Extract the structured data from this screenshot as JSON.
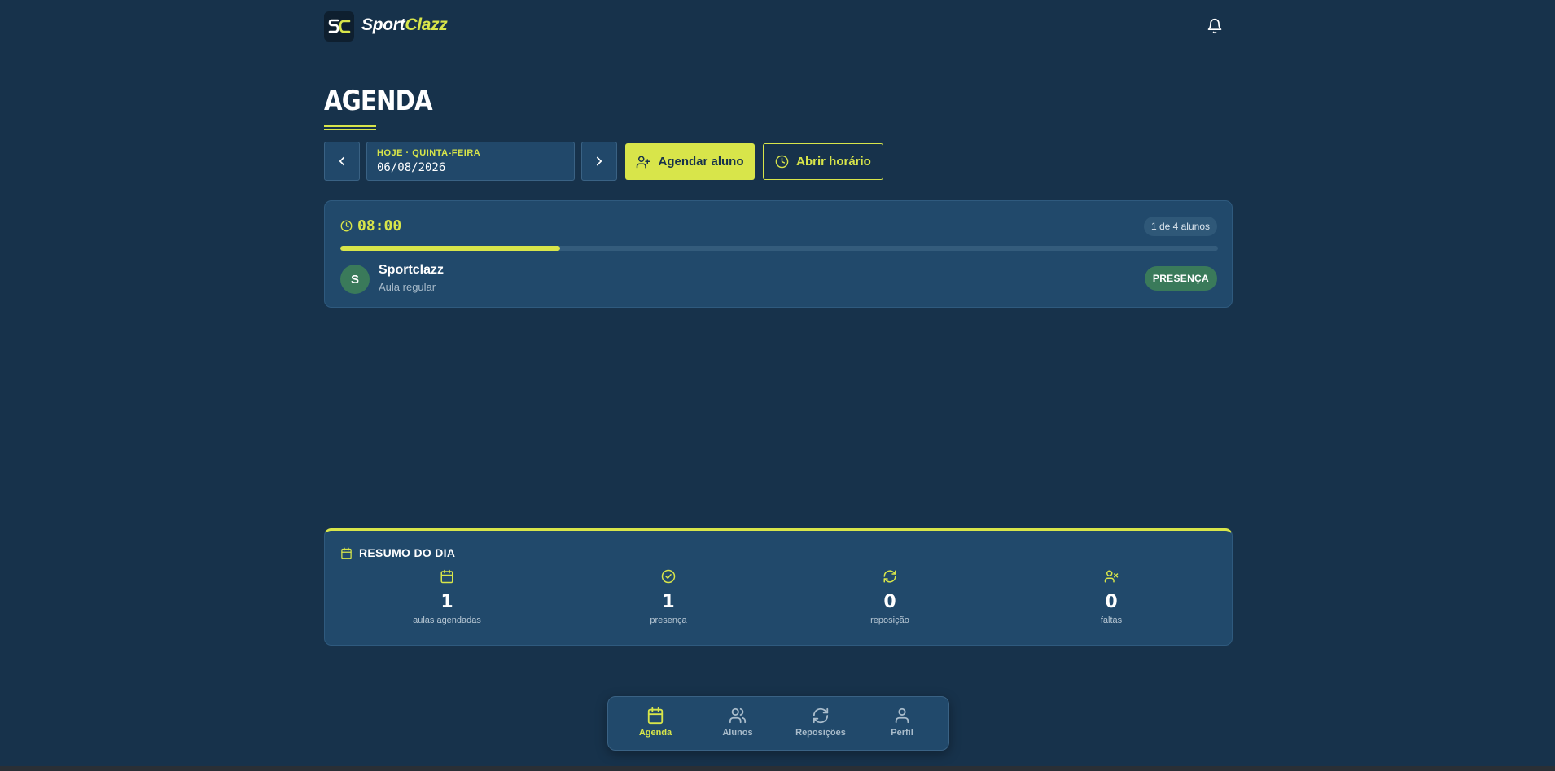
{
  "header": {
    "brand_part1": "Sport",
    "brand_part2": "Clazz",
    "logo_mark": "SC"
  },
  "page": {
    "title": "AGENDA"
  },
  "date_picker": {
    "label": "HOJE · QUINTA-FEIRA",
    "value": "06/08/2026"
  },
  "actions": {
    "schedule_student": "Agendar aluno",
    "open_slot": "Abrir horário"
  },
  "slot": {
    "time": "08:00",
    "count": "1 de 4 alunos",
    "filled": 1,
    "capacity": 4,
    "students": [
      {
        "initial": "S",
        "name": "Sportclazz",
        "type": "Aula regular",
        "status": "PRESENÇA"
      }
    ]
  },
  "summary": {
    "title": "RESUMO DO DIA",
    "stats": [
      {
        "icon": "calendar-icon",
        "value": "1",
        "label": "aulas agendadas"
      },
      {
        "icon": "check-circle-icon",
        "value": "1",
        "label": "presença"
      },
      {
        "icon": "refresh-icon",
        "value": "0",
        "label": "reposição"
      },
      {
        "icon": "user-x-icon",
        "value": "0",
        "label": "faltas"
      }
    ]
  },
  "bottom_nav": {
    "items": [
      {
        "label": "Agenda",
        "icon": "calendar-icon",
        "active": true
      },
      {
        "label": "Alunos",
        "icon": "users-icon",
        "active": false
      },
      {
        "label": "Reposições",
        "icon": "refresh-icon",
        "active": false
      },
      {
        "label": "Perfil",
        "icon": "user-icon",
        "active": false
      }
    ]
  },
  "colors": {
    "background": "#17324b",
    "card": "#21496b",
    "accent": "#d8e54a",
    "success": "#3a7a5a"
  }
}
